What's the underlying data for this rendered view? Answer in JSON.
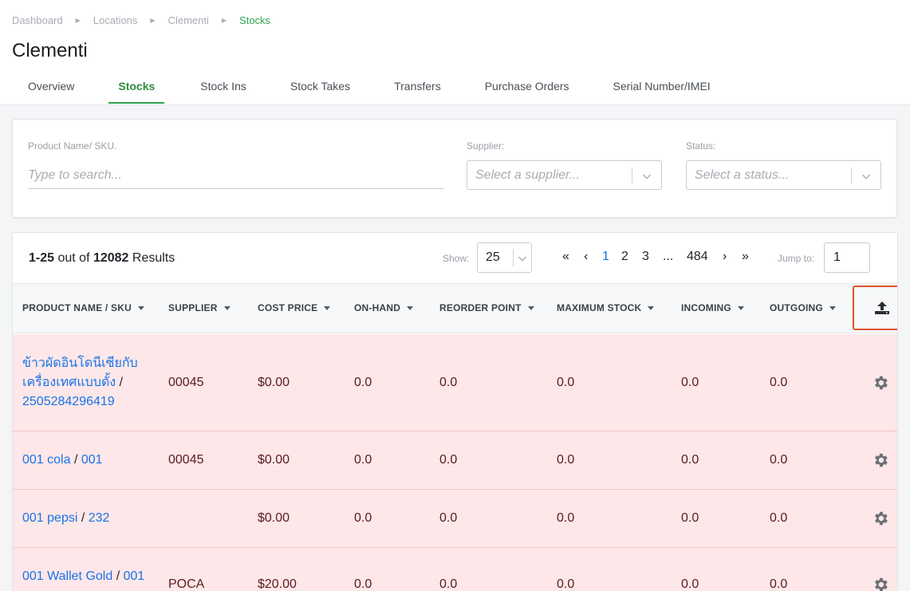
{
  "breadcrumb": [
    "Dashboard",
    "Locations",
    "Clementi",
    "Stocks"
  ],
  "page_title": "Clementi",
  "tabs": [
    "Overview",
    "Stocks",
    "Stock Ins",
    "Stock Takes",
    "Transfers",
    "Purchase Orders",
    "Serial Number/IMEI"
  ],
  "active_tab": "Stocks",
  "filters": {
    "product_label": "Product Name/ SKU.",
    "product_placeholder": "Type to search...",
    "supplier_label": "Supplier:",
    "supplier_placeholder": "Select a supplier...",
    "status_label": "Status:",
    "status_placeholder": "Select a status..."
  },
  "results": {
    "range": "1-25",
    "middle": " out of ",
    "total": "12082",
    "suffix": " Results"
  },
  "show": {
    "label": "Show:",
    "value": "25"
  },
  "pagination": {
    "first": "«",
    "prev": "‹",
    "pages": [
      "1",
      "2",
      "3"
    ],
    "ellipsis": "...",
    "last_page": "484",
    "next": "›",
    "last": "»",
    "current": "1"
  },
  "jump": {
    "label": "Jump to:",
    "value": "1"
  },
  "columns": [
    "PRODUCT NAME / SKU",
    "SUPPLIER",
    "COST PRICE",
    "ON-HAND",
    "REORDER POINT",
    "MAXIMUM STOCK",
    "INCOMING",
    "OUTGOING"
  ],
  "rows": [
    {
      "name_lines": [
        "ข้าวผัดอินโดนีเซียกับ",
        "เครื่องเทศแบบดั้ง"
      ],
      "sku": "2505284296419",
      "supplier": "00045",
      "cost": "$0.00",
      "on_hand": "0.0",
      "reorder": "0.0",
      "max_stock": "0.0",
      "incoming": "0.0",
      "outgoing": "0.0"
    },
    {
      "name_lines": [
        "001 cola"
      ],
      "sku": "001",
      "supplier": "00045",
      "cost": "$0.00",
      "on_hand": "0.0",
      "reorder": "0.0",
      "max_stock": "0.0",
      "incoming": "0.0",
      "outgoing": "0.0"
    },
    {
      "name_lines": [
        "001 pepsi"
      ],
      "sku": "232",
      "supplier": "",
      "cost": "$0.00",
      "on_hand": "0.0",
      "reorder": "0.0",
      "max_stock": "0.0",
      "incoming": "0.0",
      "outgoing": "0.0"
    },
    {
      "name_lines": [
        "001 Wallet Gold"
      ],
      "sku": "001",
      "supplier": "POCA",
      "cost": "$20.00",
      "on_hand": "0.0",
      "reorder": "0.0",
      "max_stock": "0.0",
      "incoming": "0.0",
      "outgoing": "0.0"
    }
  ],
  "colors": {
    "accent_green": "#2ea44f",
    "link_blue": "#1a73e8",
    "row_pink": "#fde7e8",
    "highlight_border": "#e0522c"
  },
  "icons": {
    "upload": "upload-icon",
    "settings": "gear-icon",
    "chevron": "chevron-down-icon"
  }
}
